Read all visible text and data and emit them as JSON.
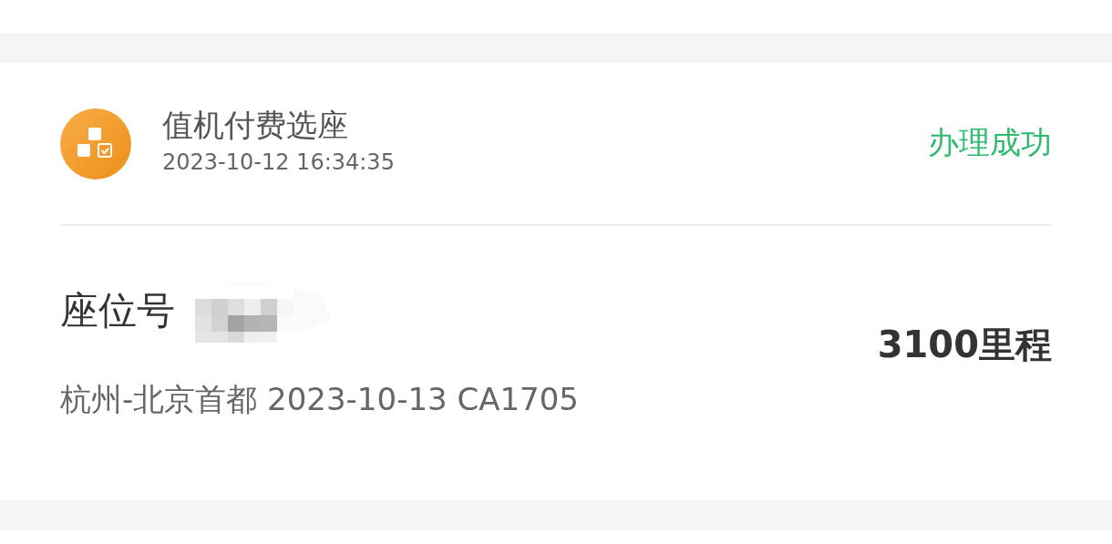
{
  "record": {
    "title": "值机付费选座",
    "time": "2023-10-12 16:34:35",
    "status": "办理成功",
    "succeeded": true,
    "seat_label": "座位号",
    "seat_value": {
      "kind": "redacted"
    },
    "route": "杭州-北京首都 2023-10-13 CA1705",
    "miles": "3100里程"
  }
}
